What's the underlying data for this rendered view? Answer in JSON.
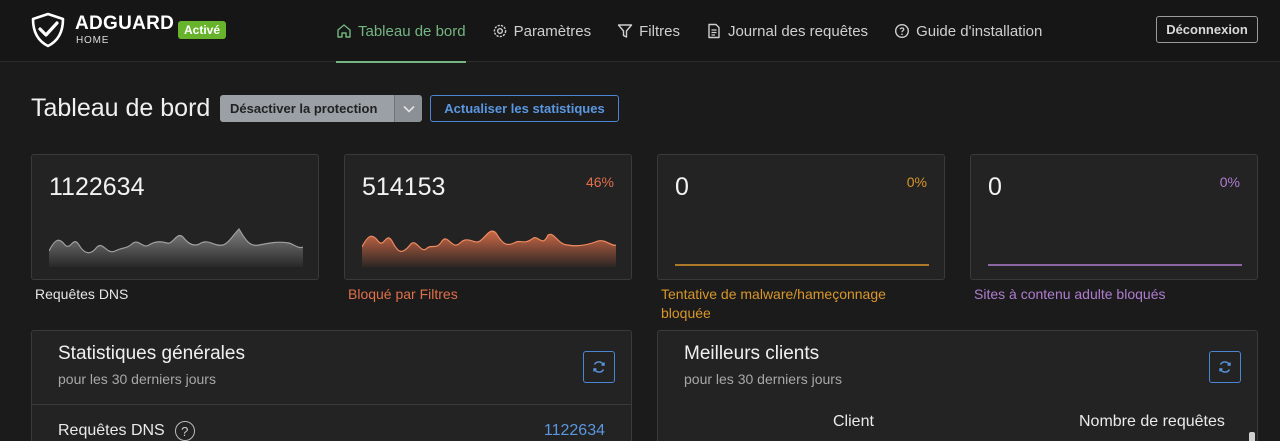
{
  "header": {
    "brand": "ADGUARD",
    "brand_sub": "HOME",
    "status_badge": "Activé",
    "nav": [
      {
        "label": "Tableau de bord",
        "icon": "home-icon",
        "active": true
      },
      {
        "label": "Paramètres",
        "icon": "gear-icon",
        "active": false
      },
      {
        "label": "Filtres",
        "icon": "filter-icon",
        "active": false
      },
      {
        "label": "Journal des requêtes",
        "icon": "document-icon",
        "active": false
      },
      {
        "label": "Guide d'installation",
        "icon": "help-circle-icon",
        "active": false
      }
    ],
    "logout": "Déconnexion"
  },
  "page": {
    "title": "Tableau de bord",
    "disable_protection": "Désactiver la protection",
    "refresh_stats": "Actualiser les statistiques"
  },
  "cards": [
    {
      "value": "1122634",
      "percent": "",
      "label": "Requêtes DNS",
      "color": "#9a9a9a",
      "label_color": "#e6e6e6"
    },
    {
      "value": "514153",
      "percent": "46%",
      "label": "Bloqué par Filtres",
      "color": "#e0704a",
      "label_color": "#e0704a"
    },
    {
      "value": "0",
      "percent": "0%",
      "label": "Tentative de malware/hameçonnage bloquée",
      "color": "#d9962a",
      "label_color": "#d9962a"
    },
    {
      "value": "0",
      "percent": "0%",
      "label": "Sites à contenu adulte bloqués",
      "color": "#b07ccf",
      "label_color": "#b07ccf"
    }
  ],
  "general_stats": {
    "title": "Statistiques générales",
    "subtitle": "pour les 30 derniers jours",
    "row_label": "Requêtes DNS",
    "row_value": "1122634"
  },
  "top_clients": {
    "title": "Meilleurs clients",
    "subtitle": "pour les 30 derniers jours",
    "col_client": "Client",
    "col_requests": "Nombre de requêtes"
  },
  "colors": {
    "accent_green": "#74b581",
    "accent_blue": "#4a86d1",
    "badge_green": "#67b42c"
  }
}
